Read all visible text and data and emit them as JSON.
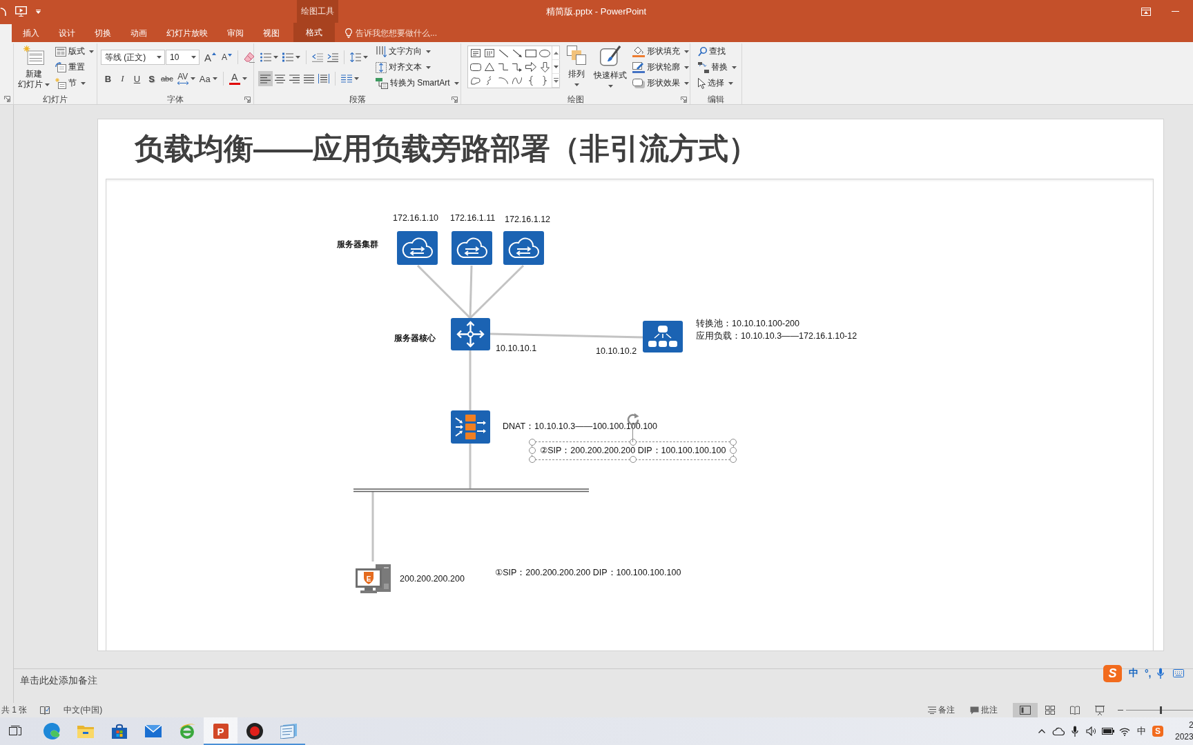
{
  "title_bar": {
    "title": "精简版.pptx - PowerPoint",
    "context_label": "绘图工具"
  },
  "tabs": [
    {
      "selected": true,
      "contextual": false
    },
    {
      "label": "插入",
      "selected": false,
      "contextual": false
    },
    {
      "label": "设计",
      "selected": false,
      "contextual": false
    },
    {
      "label": "切换",
      "selected": false,
      "contextual": false
    },
    {
      "label": "动画",
      "selected": false,
      "contextual": false
    },
    {
      "label": "幻灯片放映",
      "selected": false,
      "contextual": false
    },
    {
      "label": "审阅",
      "selected": false,
      "contextual": false
    },
    {
      "label": "视图",
      "selected": false,
      "contextual": false
    },
    {
      "label": "格式",
      "selected": false,
      "contextual": true
    }
  ],
  "tell_me": {
    "placeholder": "告诉我您想要做什么..."
  },
  "ribbon": {
    "groups": [
      {
        "launcher": true
      },
      {
        "label": "幻灯片",
        "launcher": false,
        "large": [
          {
            "lines": [
              "新建",
              "幻灯片"
            ],
            "dropdown": true
          }
        ],
        "commands": [
          {
            "label": "版式",
            "dropdown": true
          },
          {
            "label": "重置",
            "dropdown": false
          },
          {
            "label": "节",
            "dropdown": true
          }
        ]
      },
      {
        "label": "字体",
        "launcher": true,
        "toolbars": [
          {
            "items": [
              {
                "kind": "combo",
                "value": "等线 (正文)"
              },
              {
                "kind": "combo",
                "value": "10"
              },
              {
                "kind": "glyph",
                "label": "A",
                "dropdown": false,
                "selected": false
              },
              {
                "kind": "glyph",
                "label": "A",
                "dropdown": false,
                "selected": false
              },
              {
                "kind": "separator"
              },
              {
                "kind": "icon",
                "dropdown": false,
                "selected": false
              }
            ]
          },
          {
            "items": [
              {
                "kind": "glyph",
                "label": "B",
                "dropdown": false,
                "selected": false
              },
              {
                "kind": "glyph",
                "label": "I",
                "dropdown": false,
                "selected": false
              },
              {
                "kind": "glyph",
                "label": "U",
                "dropdown": false,
                "selected": false
              },
              {
                "kind": "glyph",
                "label": "S",
                "dropdown": false,
                "selected": false
              },
              {
                "kind": "glyph",
                "label": "abc",
                "dropdown": false,
                "selected": false
              },
              {
                "kind": "glyph",
                "label": "AV",
                "dropdown": true,
                "selected": false
              },
              {
                "kind": "glyph",
                "label": "Aa",
                "dropdown": true,
                "selected": false
              },
              {
                "kind": "separator"
              },
              {
                "kind": "glyph",
                "label": "A",
                "dropdown": true,
                "selected": false
              }
            ]
          }
        ]
      },
      {
        "label": "段落",
        "launcher": true,
        "toolbars": [
          {
            "items": [
              {
                "kind": "icon",
                "dropdown": true,
                "selected": false
              },
              {
                "kind": "icon",
                "dropdown": true,
                "selected": false
              },
              {
                "kind": "separator"
              },
              {
                "kind": "icon",
                "dropdown": false,
                "selected": false
              },
              {
                "kind": "icon",
                "dropdown": false,
                "selected": false
              },
              {
                "kind": "separator"
              },
              {
                "kind": "icon",
                "dropdown": true,
                "selected": false
              }
            ]
          },
          {
            "items": [
              {
                "kind": "icon",
                "dropdown": false,
                "selected": true
              },
              {
                "kind": "icon",
                "dropdown": false,
                "selected": false
              },
              {
                "kind": "icon",
                "dropdown": false,
                "selected": false
              },
              {
                "kind": "icon",
                "dropdown": false,
                "selected": false
              },
              {
                "kind": "icon",
                "dropdown": false,
                "selected": false
              },
              {
                "kind": "separator"
              },
              {
                "kind": "icon",
                "dropdown": true,
                "selected": false
              }
            ]
          }
        ],
        "commands": [
          {
            "label": "文字方向",
            "dropdown": true
          },
          {
            "label": "对齐文本",
            "dropdown": true
          },
          {
            "label": "转换为 SmartArt",
            "dropdown": true
          }
        ]
      },
      {
        "label": "绘图",
        "launcher": true,
        "gallery": true,
        "large": [
          {
            "lines": [
              "排列"
            ],
            "dropdown": true
          },
          {
            "lines": [
              "快速样式"
            ],
            "dropdown": true
          }
        ],
        "commands": [
          {
            "label": "形状填充",
            "dropdown": true
          },
          {
            "label": "形状轮廓",
            "dropdown": true
          },
          {
            "label": "形状效果",
            "dropdown": true
          }
        ]
      },
      {
        "label": "编辑",
        "launcher": false,
        "commands": [
          {
            "label": "查找",
            "dropdown": false
          },
          {
            "label": "替换",
            "dropdown": true
          },
          {
            "label": "选择",
            "dropdown": true
          }
        ]
      }
    ]
  },
  "slide": {
    "title": "负载均衡——应用负载旁路部署（非引流方式）",
    "diagram": {
      "nodes": [
        {
          "kind": "server"
        },
        {
          "kind": "server"
        },
        {
          "kind": "server"
        },
        {
          "kind": "switch"
        },
        {
          "kind": "load_balancer"
        },
        {
          "kind": "firewall"
        },
        {
          "kind": "pc",
          "badge": "E"
        }
      ],
      "labels": [
        {
          "kind": "address",
          "text": "172.16.1.10",
          "selected": false
        },
        {
          "kind": "address",
          "text": "172.16.1.11",
          "selected": false
        },
        {
          "kind": "address",
          "text": "172.16.1.12",
          "selected": false
        },
        {
          "kind": "name",
          "text": "服务器集群",
          "selected": false
        },
        {
          "kind": "name",
          "text": "服务器核心",
          "selected": false
        },
        {
          "kind": "address",
          "text": "10.10.10.1",
          "selected": false
        },
        {
          "kind": "address",
          "text": "10.10.10.2",
          "selected": false
        },
        {
          "kind": "note",
          "text": "转换池：10.10.10.100-200",
          "selected": false
        },
        {
          "kind": "note",
          "text": "应用负载：10.10.10.3——172.16.1.10-12",
          "selected": false
        },
        {
          "kind": "note",
          "text": "DNAT：10.10.10.3——100.100.100.100",
          "selected": false
        },
        {
          "kind": "note",
          "text": "②SIP：200.200.200.200 DIP：100.100.100.100",
          "selected": true
        },
        {
          "kind": "address",
          "text": "200.200.200.200",
          "selected": false
        },
        {
          "kind": "note",
          "text": "①SIP：200.200.200.200 DIP：100.100.100.100",
          "selected": false
        }
      ]
    }
  },
  "notes": {
    "placeholder": "单击此处添加备注"
  },
  "status_bar": {
    "slide_count": "共 1 张",
    "language": "中文(中国)",
    "notes": "备注",
    "comments": "批注",
    "views": [
      {
        "selected": true
      },
      {
        "selected": false
      },
      {
        "selected": false
      },
      {
        "selected": false
      }
    ],
    "zoom": {
      "level": 0.52
    }
  },
  "ime_bar": {
    "logo": "S",
    "mode": "中",
    "punctuation": "°,"
  },
  "taskbar": {
    "apps": [
      {
        "running": false,
        "selected": false
      },
      {
        "running": false,
        "selected": false
      },
      {
        "running": false,
        "selected": false
      },
      {
        "running": false,
        "selected": false
      },
      {
        "running": false,
        "selected": false
      },
      {
        "label": "P",
        "running": true,
        "selected": true
      },
      {
        "running": true,
        "selected": false
      },
      {
        "running": true,
        "selected": false
      }
    ],
    "tray": {
      "ime_mode": "中",
      "logo": "S",
      "time": "2",
      "date": "2023"
    }
  }
}
